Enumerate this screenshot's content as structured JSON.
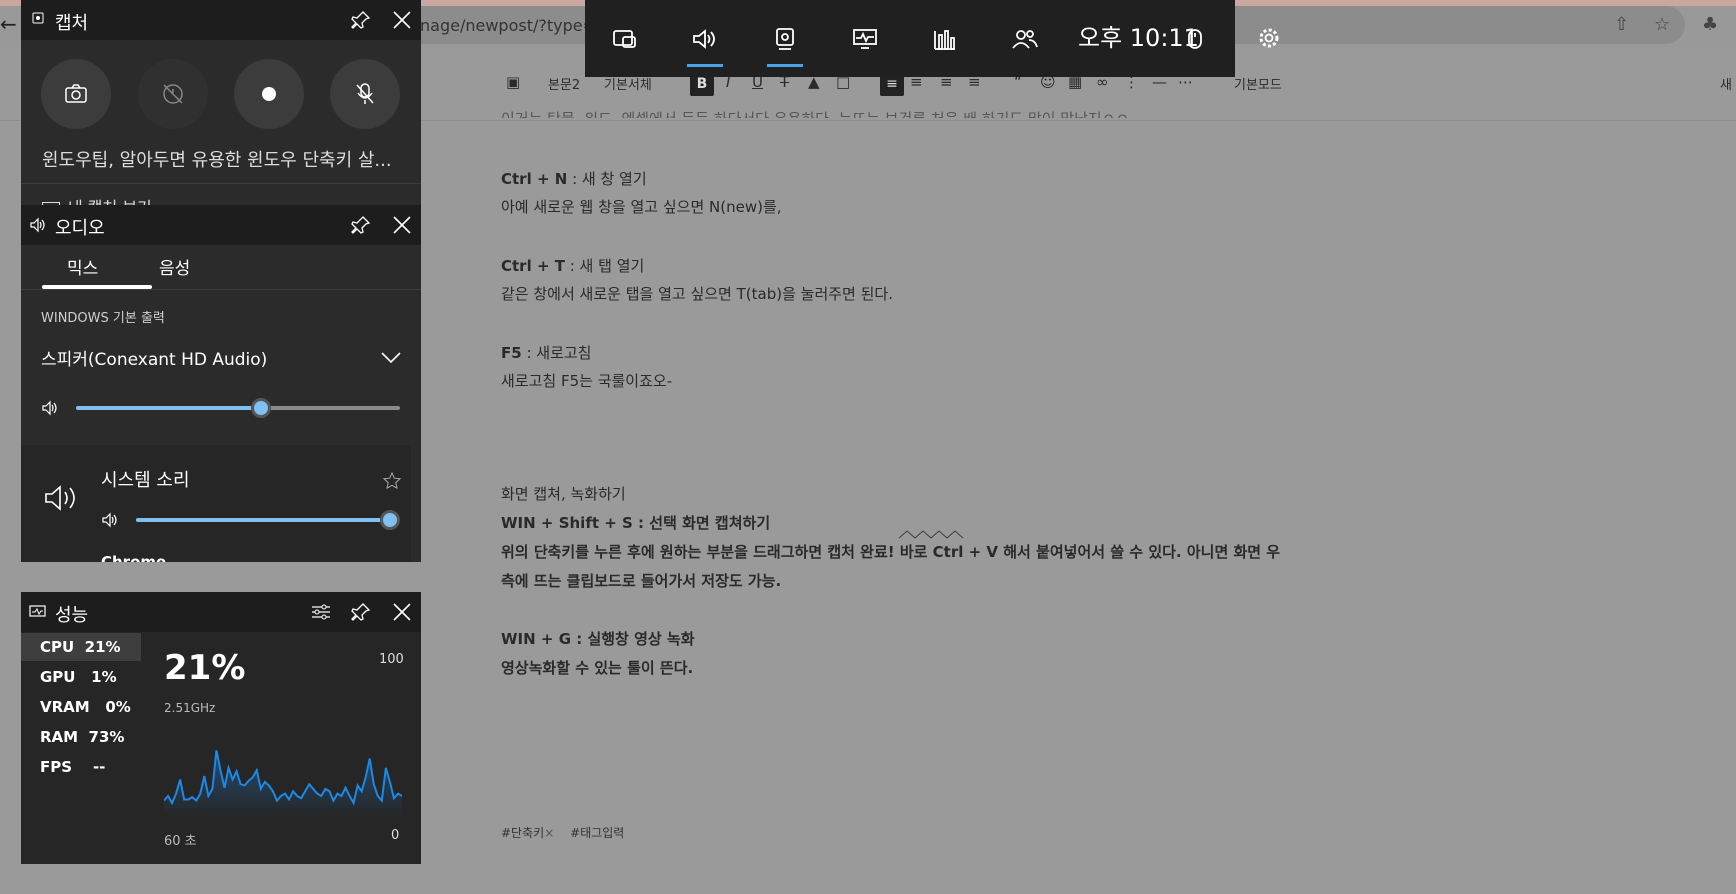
{
  "browser": {
    "url": "nage/newpost/?type=",
    "back_icon": "arrow-left-icon",
    "share_icon": "share-icon",
    "star_icon": "star-icon",
    "ext_icon": "puzzle-icon"
  },
  "editor_toolbar": {
    "style_label": "본문2",
    "font_label": "기본서체",
    "bold": "B",
    "italic": "I",
    "underline": "U",
    "strike": "T",
    "mode_label": "기본모드",
    "right_cut": "새"
  },
  "article": {
    "top_cut": "이거는 탁물, 워드, 엑셀에서 등등 하다서다 유용하다. 눈뜨는 보건록 처음 배 하기도 많이 맞났지ㅇㅇ",
    "ctrl_n_key": "Ctrl + N",
    "ctrl_n_desc": " : 새 창 열기",
    "ctrl_n_body": "아예 새로운 웹 창을 열고 싶으면 N(new)를,",
    "ctrl_t_key": "Ctrl + T",
    "ctrl_t_desc": " : 새 탭 열기",
    "ctrl_t_body": "같은 창에서 새로운 탭을 열고 싶으면 T(tab)을 눌러주면 된다.",
    "f5_key": "F5",
    "f5_desc": " : 새로고침",
    "f5_body": "새로고침 F5는 국룰이죠오-",
    "section_title": "화면 캡쳐, 녹화하기",
    "win_shift_s": "WIN + Shift + S : 선택 화면 캡쳐하기",
    "para1_a": "위의 단축키를 누른 후에 원하는 부분을 드래그하면 캡처 완료! 바로 ",
    "para1_key": "Ctrl + V",
    "para1_b": " 해서 붙여넣어서 쓸 수 있다. 아니면 화면 우",
    "para1_c": "측에 뜨는 클립보드로 들어가서 저장도 가능.",
    "win_g": "WIN + G : ",
    "win_g_desc": "실행창 영상 녹화",
    "win_g_body": "영상녹화할 수 있는 툴이 뜬다.",
    "tags": [
      "#단축키",
      "#태그입력"
    ],
    "tag_remove": "×"
  },
  "gamebar": {
    "time": "오후 10:11",
    "buttons": [
      "widget-menu-icon",
      "audio-icon",
      "capture-icon",
      "performance-icon",
      "resources-icon",
      "social-icon"
    ],
    "mouse_icon": "mouse-icon",
    "settings_icon": "gear-icon"
  },
  "capture": {
    "title": "캡처",
    "recent": "윈도우팁, 알아두면 유용한 윈도우 단축키 살...",
    "link": "내 캡처 보기"
  },
  "audio": {
    "title": "오디오",
    "tabs": [
      "믹스",
      "음성"
    ],
    "section": "WINDOWS 기본 출력",
    "device": "스피커(Conexant HD Audio)",
    "master_volume": 0.57,
    "system_label": "시스템 소리",
    "system_volume": 1.0,
    "chrome_label": "Chrome"
  },
  "performance": {
    "title": "성능",
    "items": [
      {
        "name": "CPU",
        "value": "21%"
      },
      {
        "name": "GPU",
        "value": "1%"
      },
      {
        "name": "VRAM",
        "value": "0%"
      },
      {
        "name": "RAM",
        "value": "73%"
      },
      {
        "name": "FPS",
        "value": "--"
      }
    ],
    "big_value": "21%",
    "freq": "2.51GHz",
    "max": "100",
    "min": "0",
    "window": "60 초",
    "graph": [
      14,
      18,
      12,
      20,
      32,
      15,
      15,
      17,
      14,
      20,
      35,
      18,
      24,
      57,
      40,
      25,
      42,
      32,
      39,
      28,
      27,
      31,
      34,
      40,
      24,
      30,
      27,
      22,
      14,
      18,
      20,
      15,
      22,
      18,
      16,
      22,
      28,
      24,
      20,
      18,
      24,
      22,
      14,
      20,
      18,
      25,
      18,
      12,
      27,
      22,
      34,
      50,
      28,
      18,
      14,
      42,
      30,
      16,
      20,
      18
    ]
  }
}
